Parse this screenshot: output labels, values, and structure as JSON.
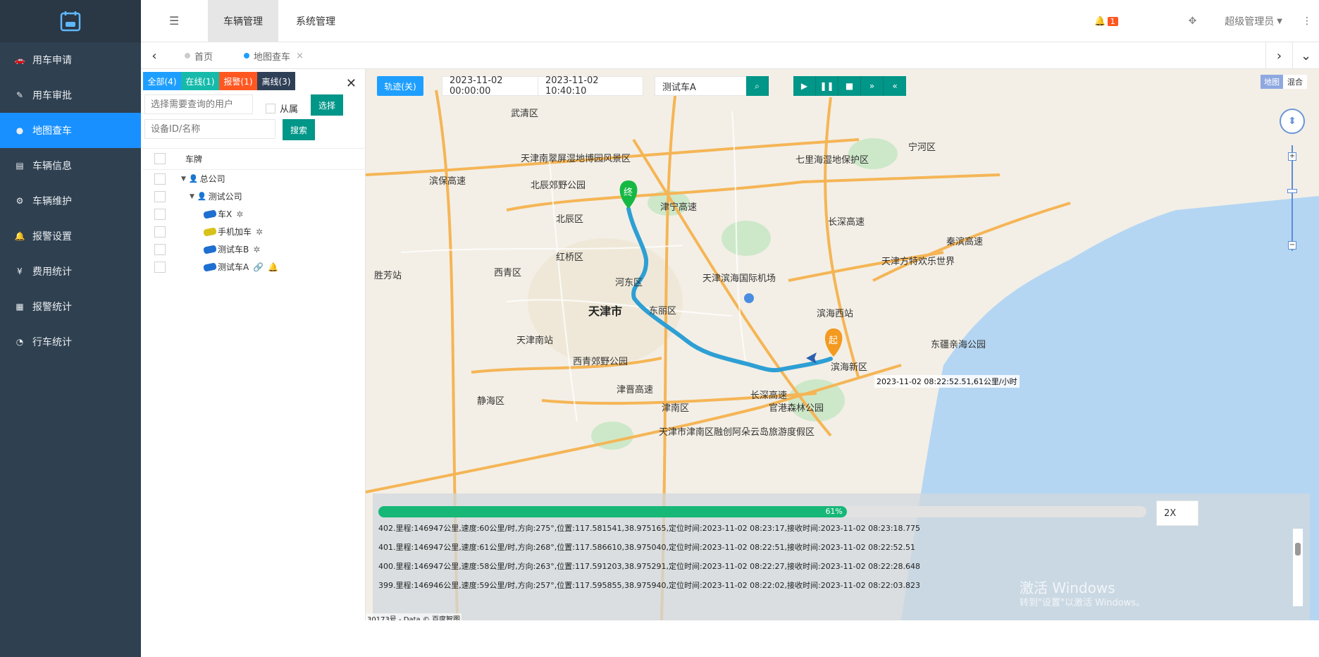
{
  "sidebar": {
    "items": [
      {
        "label": "用车申请",
        "icon": "car-icon"
      },
      {
        "label": "用车审批",
        "icon": "edit-icon"
      },
      {
        "label": "地图查车",
        "icon": "map-pin-icon"
      },
      {
        "label": "车辆信息",
        "icon": "file-icon"
      },
      {
        "label": "车辆维护",
        "icon": "gear-icon"
      },
      {
        "label": "报警设置",
        "icon": "bell-icon"
      },
      {
        "label": "费用统计",
        "icon": "money-icon"
      },
      {
        "label": "报警统计",
        "icon": "calculator-icon"
      },
      {
        "label": "行车统计",
        "icon": "pie-chart-icon"
      }
    ],
    "active_index": 2
  },
  "topbar": {
    "nav": [
      "车辆管理",
      "系统管理"
    ],
    "notification_count": "1",
    "user": "超级管理员"
  },
  "tabs": {
    "items": [
      {
        "label": "首页",
        "dot_color": "#cccccc"
      },
      {
        "label": "地图查车",
        "dot_color": "#1e9fff"
      }
    ]
  },
  "panel": {
    "filters": [
      {
        "label": "全部(4)",
        "color": "#1e9fff"
      },
      {
        "label": "在线(1)",
        "color": "#16baaa"
      },
      {
        "label": "报警(1)",
        "color": "#ff5722"
      },
      {
        "label": "离线(3)",
        "color": "#2f4056"
      }
    ],
    "user_placeholder": "选择需要查询的用户",
    "subordinate_label": "从属",
    "select_label": "选择",
    "device_placeholder": "设备ID/名称",
    "search_label": "搜索",
    "column_header": "车牌",
    "tree": [
      {
        "label": "总公司",
        "type": "company",
        "level": 0
      },
      {
        "label": "测试公司",
        "type": "company",
        "level": 1
      },
      {
        "label": "车X",
        "type": "vehicle",
        "status": "offline"
      },
      {
        "label": "手机加车",
        "type": "vehicle",
        "status": "offline"
      },
      {
        "label": "测试车B",
        "type": "vehicle",
        "status": "offline"
      },
      {
        "label": "测试车A",
        "type": "vehicle",
        "status": "online-alarm"
      }
    ]
  },
  "map": {
    "track_toggle": "轨迹(关)",
    "start_time": "2023-11-02 00:00:00",
    "end_time": "2023-11-02 10:40:10",
    "vehicle": "测试车A",
    "map_type": [
      "地图",
      "混合"
    ],
    "tooltip": "2023-11-02 08:22:52.51,61公里/小时",
    "start_marker": "起",
    "end_marker": "终",
    "attribution": "30173号 - Data © 百度智图",
    "labels": [
      {
        "text": "天津市",
        "big": true
      },
      {
        "text": "滨海新区"
      },
      {
        "text": "东丽区"
      },
      {
        "text": "河东区"
      },
      {
        "text": "红桥区"
      },
      {
        "text": "西青区"
      },
      {
        "text": "北辰区"
      },
      {
        "text": "津南区"
      },
      {
        "text": "静海区"
      },
      {
        "text": "宁河区"
      },
      {
        "text": "武清区"
      },
      {
        "text": "天津滨海国际机场"
      },
      {
        "text": "滨海西站"
      },
      {
        "text": "天津南站"
      },
      {
        "text": "胜芳站"
      },
      {
        "text": "官港森林公园"
      },
      {
        "text": "东疆亲海公园"
      },
      {
        "text": "天津方特欢乐世界"
      },
      {
        "text": "北辰郊野公园"
      },
      {
        "text": "西青郊野公园"
      },
      {
        "text": "七里海湿地保护区"
      },
      {
        "text": "天津南翠屏湿地博园风景区"
      },
      {
        "text": "天津市津南区融创阿朵云岛旅游度假区"
      },
      {
        "text": "滨保高速"
      },
      {
        "text": "津宁高速"
      },
      {
        "text": "长深高速"
      },
      {
        "text": "津晋高速"
      },
      {
        "text": "秦滨高速"
      },
      {
        "text": "长深高速"
      }
    ],
    "playback": {
      "progress": 61,
      "progress_label": "61%",
      "speed": "2X",
      "logs": [
        "402.里程:146947公里,速度:60公里/时,方向:275°,位置:117.581541,38.975165,定位时间:2023-11-02 08:23:17,接收时间:2023-11-02 08:23:18.775",
        "401.里程:146947公里,速度:61公里/时,方向:268°,位置:117.586610,38.975040,定位时间:2023-11-02 08:22:51,接收时间:2023-11-02 08:22:52.51",
        "400.里程:146947公里,速度:58公里/时,方向:263°,位置:117.591203,38.975291,定位时间:2023-11-02 08:22:27,接收时间:2023-11-02 08:22:28.648",
        "399.里程:146946公里,速度:59公里/时,方向:257°,位置:117.595855,38.975940,定位时间:2023-11-02 08:22:02,接收时间:2023-11-02 08:22:03.823"
      ]
    },
    "watermark": "激活 Windows",
    "watermark_sub": "转到\"设置\"以激活 Windows。"
  }
}
